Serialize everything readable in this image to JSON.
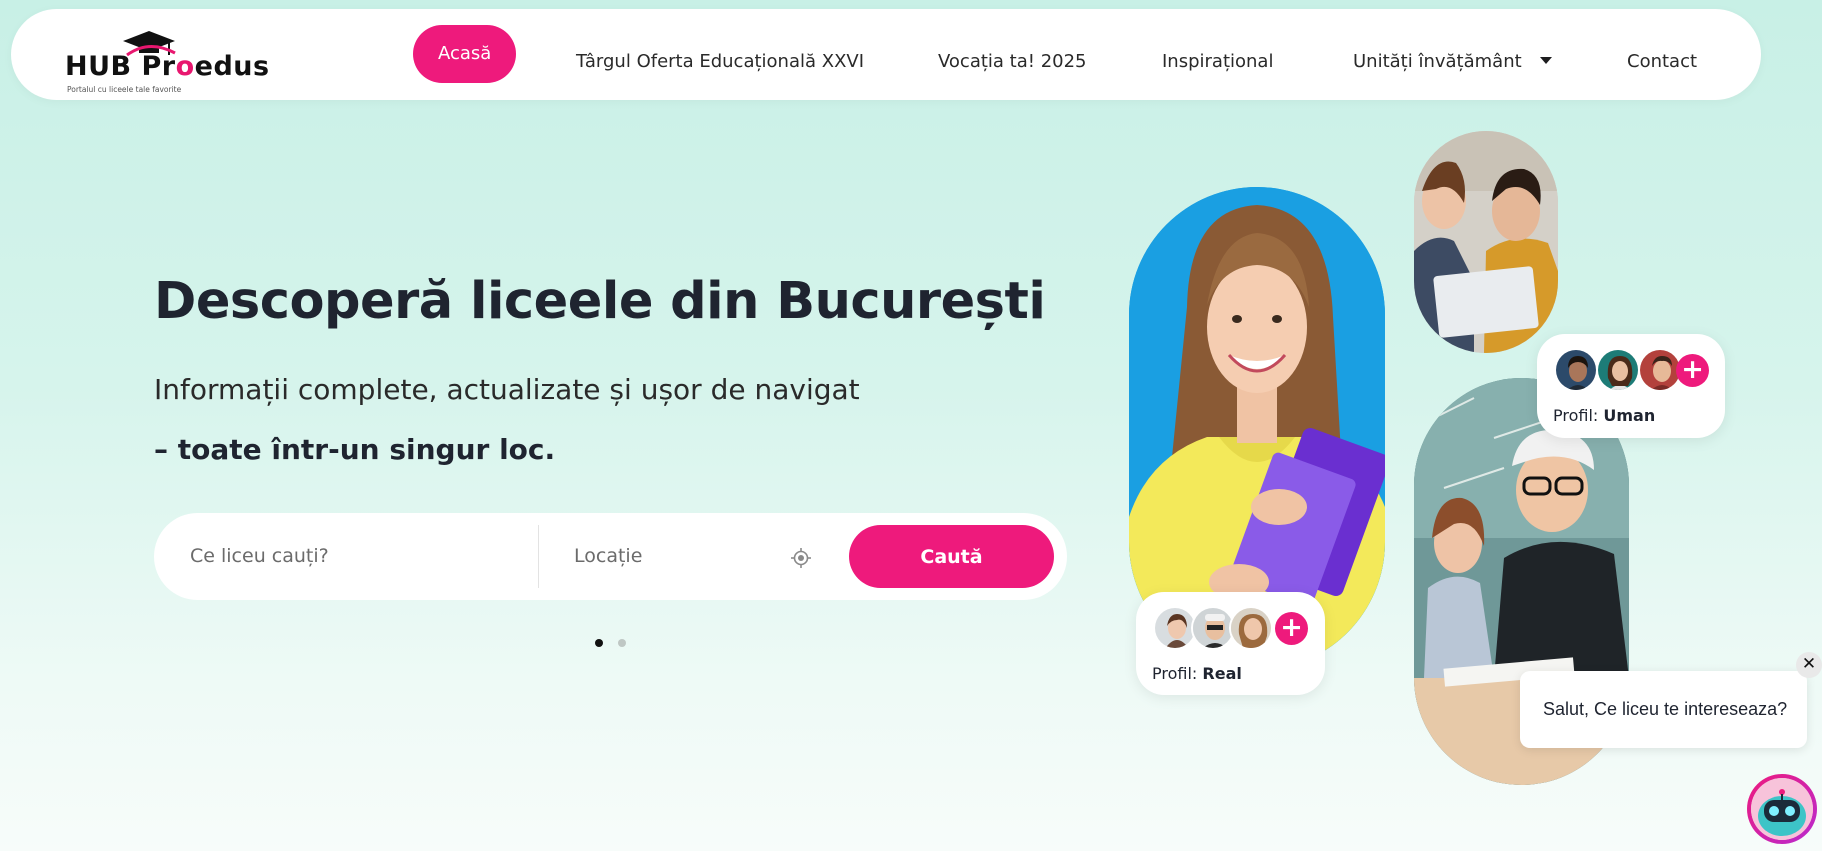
{
  "brand": {
    "name_part1": "HUB Pr",
    "name_part2": "o",
    "name_part3": "edus",
    "tagline": "Portalul cu liceele tale favorite",
    "accent_color": "#ee1a7c"
  },
  "nav": {
    "items": [
      {
        "label": "Acasă",
        "active": true
      },
      {
        "label": "Târgul Oferta Educațională XXVI",
        "active": false
      },
      {
        "label": "Vocația ta! 2025",
        "active": false
      },
      {
        "label": "Inspirațional",
        "active": false
      },
      {
        "label": "Unități învățământ",
        "active": false,
        "has_dropdown": true
      },
      {
        "label": "Contact",
        "active": false
      }
    ]
  },
  "hero": {
    "title": "Descoperă liceele din București",
    "subtitle": "Informații complete, actualizate și ușor de navigat",
    "subtitle_bold": "– toate într-un singur loc."
  },
  "search": {
    "query_placeholder": "Ce liceu cauți?",
    "location_placeholder": "Locație",
    "button_label": "Caută",
    "locate_icon": "crosshair-icon"
  },
  "carousel": {
    "total": 2,
    "active_index": 0
  },
  "profiles": [
    {
      "prefix": "Profil:",
      "name": "Real"
    },
    {
      "prefix": "Profil:",
      "name": "Uman"
    }
  ],
  "profile_plus": "+",
  "chat": {
    "message": "Salut, Ce liceu te intereseaza?",
    "close_label": "✕"
  }
}
